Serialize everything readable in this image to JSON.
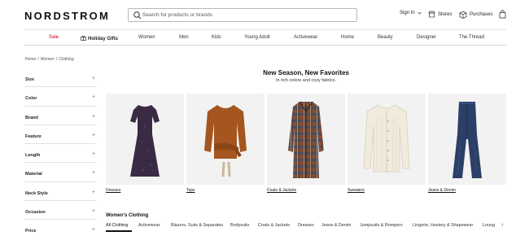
{
  "brand": "NORDSTROM",
  "search": {
    "placeholder": "Search for products or brands"
  },
  "utility": {
    "signin": "Sign In",
    "stores": "Stores",
    "purchases": "Purchases"
  },
  "nav": [
    "Sale",
    "Holiday Gifts",
    "Women",
    "Men",
    "Kids",
    "Young Adult",
    "Activewear",
    "Home",
    "Beauty",
    "Designer",
    "The Thread"
  ],
  "breadcrumb": [
    "Home",
    "/",
    "Women",
    "/",
    "Clothing"
  ],
  "filters": [
    "Size",
    "Color",
    "Brand",
    "Feature",
    "Length",
    "Material",
    "Neck Style",
    "Occasion",
    "Price"
  ],
  "hero": {
    "title": "New Season, New Favorites",
    "subtitle": "In rich colors and cozy fabrics."
  },
  "tiles": [
    {
      "label": "Dresses",
      "icon": "dress-image"
    },
    {
      "label": "Tops",
      "icon": "top-image"
    },
    {
      "label": "Coats & Jackets",
      "icon": "coat-image"
    },
    {
      "label": "Sweaters",
      "icon": "sweater-image"
    },
    {
      "label": "Jeans & Denim",
      "icon": "jeans-image"
    }
  ],
  "section": {
    "title": "Women's Clothing"
  },
  "tabs": [
    "All Clothing",
    "Activewear",
    "Blazers, Suits & Separates",
    "Bodysuits",
    "Coats & Jackets",
    "Dresses",
    "Jeans & Denim",
    "Jumpsuits & Rompers",
    "Lingerie, Hosiery & Shapewear",
    "Loung"
  ],
  "colors": {
    "sale": "#d0021b",
    "tile_bg": "#f2f2f2"
  }
}
